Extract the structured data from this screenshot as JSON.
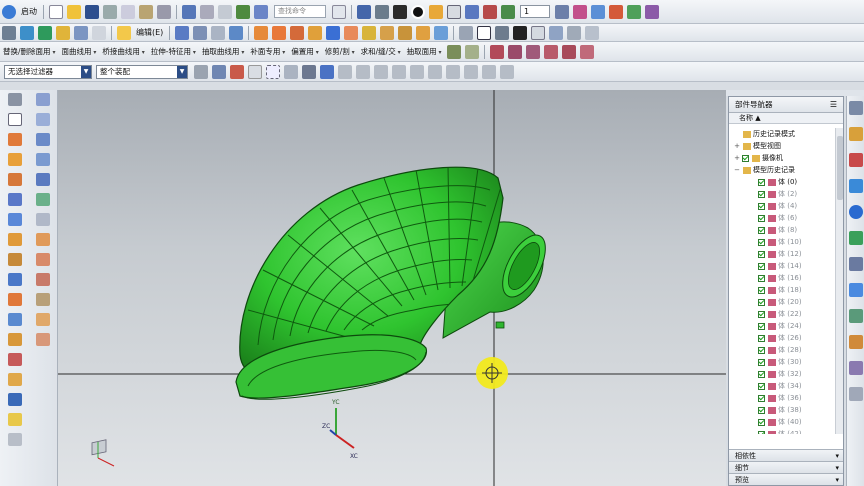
{
  "toolbar_main": {
    "start_label": "启动",
    "search_placeholder": "查找命令",
    "layer_value": "1"
  },
  "toolbar_edit": {
    "edit_label": "编辑(E)"
  },
  "menus": [
    "替换/删除面用",
    "面曲线用",
    "桥接曲线用",
    "拉伸-特征用",
    "抽取曲线用",
    "补面专用",
    "偏置用",
    "修剪/割",
    "求和/缝/交",
    "抽取面用"
  ],
  "selection_bar": {
    "filter_value": "无选择过滤器",
    "scope_value": "整个装配"
  },
  "navigator": {
    "title": "部件导航器",
    "column_name": "名称",
    "items": [
      {
        "label": "历史记录模式",
        "level": 0,
        "expander": "",
        "checked": false,
        "gray": false
      },
      {
        "label": "模型视图",
        "level": 0,
        "expander": "+",
        "checked": false,
        "gray": false
      },
      {
        "label": "摄像机",
        "level": 0,
        "expander": "+",
        "checked": true,
        "gray": false
      },
      {
        "label": "模型历史记录",
        "level": 0,
        "expander": "−",
        "checked": false,
        "gray": false
      },
      {
        "label": "体 (0)",
        "level": 1,
        "expander": "",
        "checked": true,
        "gray": false
      },
      {
        "label": "体 (2)",
        "level": 1,
        "expander": "",
        "checked": true,
        "gray": true
      },
      {
        "label": "体 (4)",
        "level": 1,
        "expander": "",
        "checked": true,
        "gray": true
      },
      {
        "label": "体 (6)",
        "level": 1,
        "expander": "",
        "checked": true,
        "gray": true
      },
      {
        "label": "体 (8)",
        "level": 1,
        "expander": "",
        "checked": true,
        "gray": true
      },
      {
        "label": "体 (10)",
        "level": 1,
        "expander": "",
        "checked": true,
        "gray": true
      },
      {
        "label": "体 (12)",
        "level": 1,
        "expander": "",
        "checked": true,
        "gray": true
      },
      {
        "label": "体 (14)",
        "level": 1,
        "expander": "",
        "checked": true,
        "gray": true
      },
      {
        "label": "体 (16)",
        "level": 1,
        "expander": "",
        "checked": true,
        "gray": true
      },
      {
        "label": "体 (18)",
        "level": 1,
        "expander": "",
        "checked": true,
        "gray": true
      },
      {
        "label": "体 (20)",
        "level": 1,
        "expander": "",
        "checked": true,
        "gray": true
      },
      {
        "label": "体 (22)",
        "level": 1,
        "expander": "",
        "checked": true,
        "gray": true
      },
      {
        "label": "体 (24)",
        "level": 1,
        "expander": "",
        "checked": true,
        "gray": true
      },
      {
        "label": "体 (26)",
        "level": 1,
        "expander": "",
        "checked": true,
        "gray": true
      },
      {
        "label": "体 (28)",
        "level": 1,
        "expander": "",
        "checked": true,
        "gray": true
      },
      {
        "label": "体 (30)",
        "level": 1,
        "expander": "",
        "checked": true,
        "gray": true
      },
      {
        "label": "体 (32)",
        "level": 1,
        "expander": "",
        "checked": true,
        "gray": true
      },
      {
        "label": "体 (34)",
        "level": 1,
        "expander": "",
        "checked": true,
        "gray": true
      },
      {
        "label": "体 (36)",
        "level": 1,
        "expander": "",
        "checked": true,
        "gray": true
      },
      {
        "label": "体 (38)",
        "level": 1,
        "expander": "",
        "checked": true,
        "gray": true
      },
      {
        "label": "体 (40)",
        "level": 1,
        "expander": "",
        "checked": true,
        "gray": true
      },
      {
        "label": "体 (42)",
        "level": 1,
        "expander": "",
        "checked": true,
        "gray": true
      }
    ],
    "sections": [
      "相依性",
      "细节",
      "预览"
    ]
  },
  "viewport": {
    "triad_labels": {
      "xc": "XC",
      "yc": "YC",
      "zc": "ZC"
    },
    "colors": {
      "model": "#2fc42f",
      "model_dark": "#1c7f1c",
      "model_edge": "#0d4a0d",
      "crosshair": "#2b2b2b",
      "cursor": "#f2ea1c"
    }
  }
}
